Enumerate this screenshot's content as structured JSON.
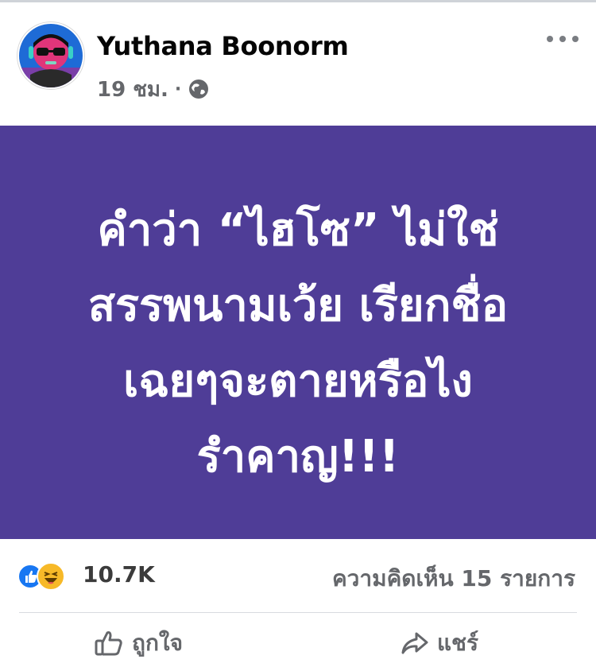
{
  "post": {
    "author": "Yuthana Boonorm",
    "time": "19 ชม.",
    "separator": "·",
    "privacy_icon": "globe-icon",
    "more_icon": "more-icon",
    "text_lines": [
      "คำว่า “ไฮโซ” ไม่ใช่",
      "สรรพนามเว้ย เรียกชื่อ",
      "เฉยๆจะตายหรือไง",
      "รำคาญ!!!"
    ],
    "background_color": "#4f3d97",
    "text_color": "#ffffff"
  },
  "reactions": {
    "icons": [
      "like-reaction-icon",
      "haha-reaction-icon"
    ],
    "count": "10.7K",
    "comments": "ความคิดเห็น 15 รายการ"
  },
  "actions": {
    "like_label": "ถูกใจ",
    "share_label": "แชร์"
  },
  "colors": {
    "like_blue": "#1877f2",
    "haha_yellow": "#f7b928",
    "secondary_text": "#65676b"
  }
}
